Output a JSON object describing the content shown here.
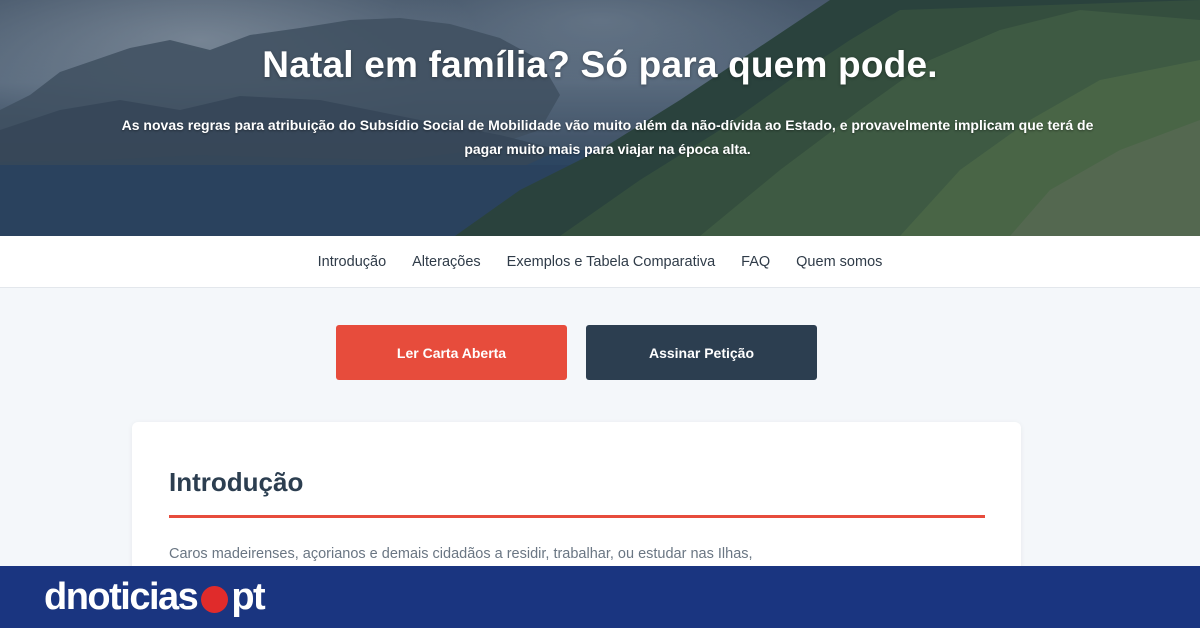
{
  "hero": {
    "title": "Natal em família? Só para quem pode.",
    "subtitle": "As novas regras para atribuição do Subsídio Social de Mobilidade vão muito além da não-dívida ao Estado, e provavelmente implicam que terá de pagar muito mais para viajar na época alta."
  },
  "nav": {
    "items": [
      {
        "label": "Introdução"
      },
      {
        "label": "Alterações"
      },
      {
        "label": "Exemplos e Tabela Comparativa"
      },
      {
        "label": "FAQ"
      },
      {
        "label": "Quem somos"
      }
    ]
  },
  "actions": {
    "primary_label": "Ler Carta Aberta",
    "secondary_label": "Assinar Petição"
  },
  "section": {
    "title": "Introdução",
    "text": "Caros madeirenses, açorianos e demais cidadãos a residir, trabalhar, ou estudar nas Ilhas,"
  },
  "brand": {
    "name_left": "dnoticias",
    "name_right": "pt",
    "bar_color": "#1a3580",
    "dot_color": "#e02b2b"
  },
  "colors": {
    "accent_red": "#e74c3c",
    "dark_navy": "#2c3e50"
  }
}
